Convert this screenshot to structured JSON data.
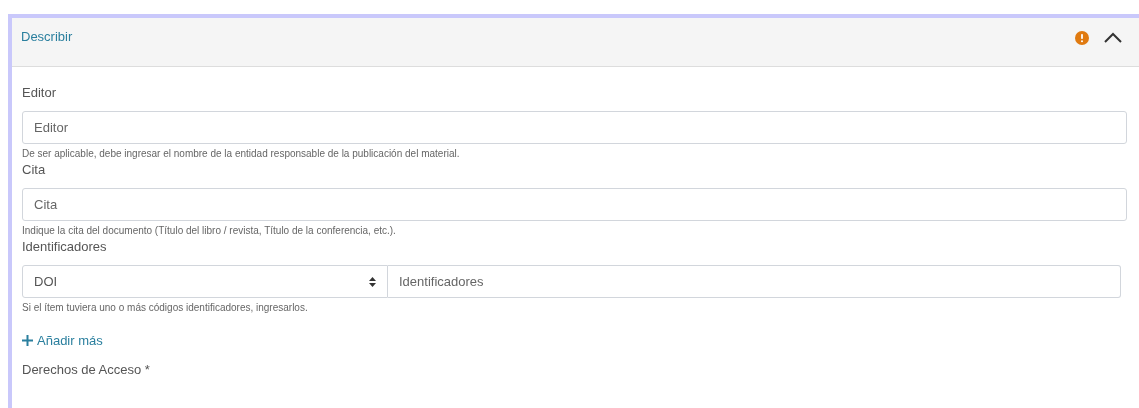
{
  "section": {
    "title": "Describir",
    "warning": true,
    "expanded": true
  },
  "fields": [
    {
      "kind": "text",
      "label": "Editor",
      "placeholder": "Editor",
      "help": "De ser aplicable, debe ingresar el nombre de la entidad responsable de la publicación del material."
    },
    {
      "kind": "text",
      "label": "Cita",
      "placeholder": "Cita",
      "help": "Indique la cita del documento (Título del libro / revista, Título de la conferencia, etc.)."
    },
    {
      "kind": "identifier",
      "label": "Identificadores",
      "select": "DOI",
      "placeholder": "Identificadores",
      "help": "Si el ítem tuviera uno o más códigos identificadores, ingresarlos.",
      "add_more": "Añadir más"
    },
    {
      "kind": "heading",
      "label": "Derechos de Acceso *"
    }
  ]
}
